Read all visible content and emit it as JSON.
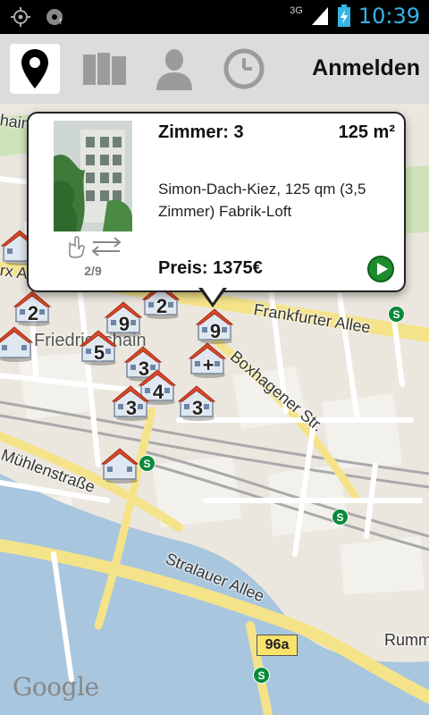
{
  "status_bar": {
    "network": "3G",
    "time": "10:39"
  },
  "action_bar": {
    "login_label": "Anmelden",
    "tabs": [
      {
        "icon": "map-pin-icon",
        "selected": true
      },
      {
        "icon": "folder-icon",
        "selected": false
      },
      {
        "icon": "person-icon",
        "selected": false
      },
      {
        "icon": "clock-icon",
        "selected": false
      }
    ]
  },
  "popup": {
    "rooms": "Zimmer: 3",
    "area": "125 m²",
    "description": "Simon-Dach-Kiez, 125 qm (3,5 Zimmer) Fabrik-Loft",
    "price": "Preis: 1375€",
    "counter": "2/9"
  },
  "map": {
    "streets": {
      "frankfurter": "Frankfurter Allee",
      "boxhagener": "Boxhagener Str.",
      "muehlen": "Mühlenstraße",
      "stralauer": "Stralauer Allee",
      "rumm": "Rumm",
      "top_left": "hain",
      "left_edge": "rx A"
    },
    "district": "Friedrichshain",
    "road_badge": "96a",
    "attribution": "Google",
    "markers": [
      {
        "label": "2"
      },
      {
        "label": "9"
      },
      {
        "label": "5"
      },
      {
        "label": "3"
      },
      {
        "label": "4"
      },
      {
        "label": "3"
      },
      {
        "label": "3"
      },
      {
        "label": "9"
      },
      {
        "label": "+"
      },
      {
        "label": ""
      },
      {
        "label": ""
      },
      {
        "label": ""
      },
      {
        "label": "2"
      }
    ]
  }
}
